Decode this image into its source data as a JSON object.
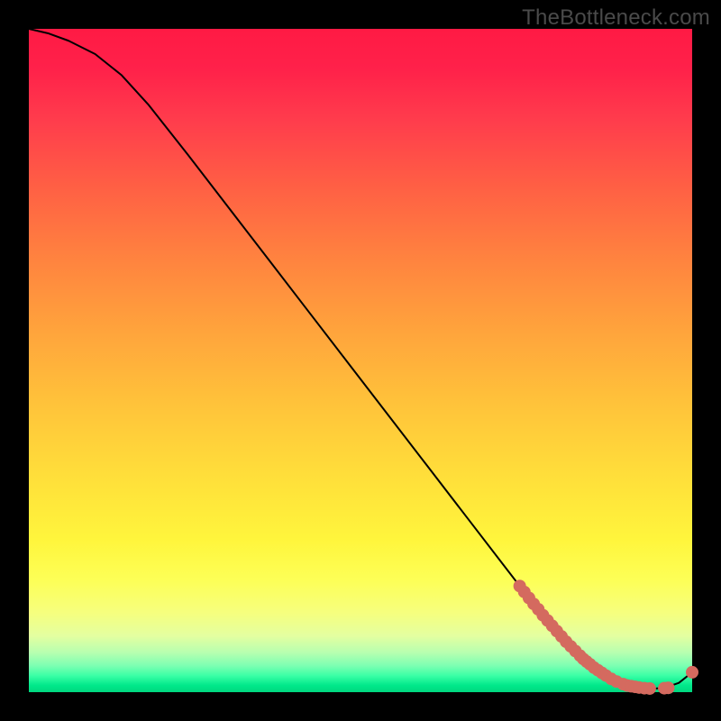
{
  "watermark": "TheBottleneck.com",
  "chart_data": {
    "type": "line",
    "title": "",
    "xlabel": "",
    "ylabel": "",
    "xlim": [
      0,
      100
    ],
    "ylim": [
      0,
      100
    ],
    "grid": false,
    "legend": false,
    "series": [
      {
        "name": "curve",
        "color": "#000000",
        "x": [
          0,
          3,
          6,
          10,
          14,
          18,
          24,
          30,
          36,
          42,
          48,
          54,
          60,
          66,
          72,
          76,
          80,
          82,
          84,
          86,
          88,
          90,
          92,
          94,
          96,
          98,
          100
        ],
        "y": [
          100,
          99.3,
          98.2,
          96.2,
          93.0,
          88.6,
          81.0,
          73.2,
          65.4,
          57.6,
          49.8,
          42.0,
          34.2,
          26.4,
          18.6,
          13.4,
          8.6,
          6.4,
          4.6,
          3.0,
          1.8,
          1.0,
          0.6,
          0.5,
          0.7,
          1.4,
          3.0
        ]
      }
    ],
    "markers": [
      {
        "name": "highlight-points",
        "color": "#d46a5f",
        "x": [
          74.0,
          74.7,
          75.4,
          76.1,
          76.8,
          77.5,
          78.2,
          78.9,
          79.6,
          80.3,
          81.0,
          81.7,
          82.4,
          83.1,
          83.6,
          84.1,
          84.6,
          85.2,
          85.8,
          86.4,
          87.0,
          87.8,
          88.6,
          89.6,
          90.2,
          90.8,
          91.4,
          92.0,
          92.8,
          93.6,
          95.8,
          96.4,
          100.0
        ],
        "y": [
          16.0,
          15.1,
          14.2,
          13.3,
          12.5,
          11.6,
          10.8,
          10.0,
          9.2,
          8.4,
          7.6,
          6.9,
          6.2,
          5.5,
          5.0,
          4.6,
          4.2,
          3.7,
          3.3,
          2.9,
          2.5,
          2.0,
          1.6,
          1.2,
          1.0,
          0.9,
          0.8,
          0.7,
          0.6,
          0.55,
          0.6,
          0.65,
          3.0
        ]
      }
    ]
  }
}
